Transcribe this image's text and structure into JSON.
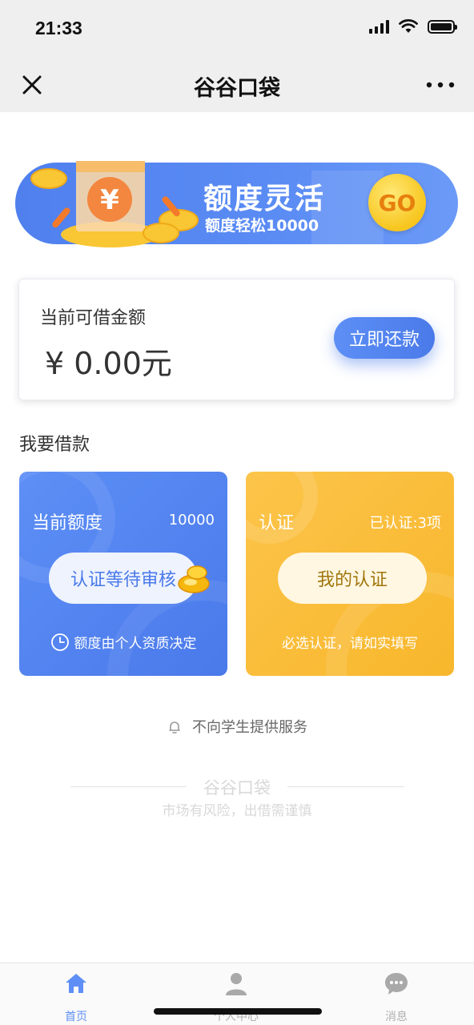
{
  "status_bar": {
    "time": "21:33"
  },
  "nav": {
    "title": "谷谷口袋"
  },
  "banner": {
    "title": "额度灵活",
    "subtitle": "额度轻松10000",
    "go_label": "GO"
  },
  "balance": {
    "label": "当前可借金额",
    "amount": "¥ 0.00元",
    "repay_label": "立即还款"
  },
  "section_title": "我要借款",
  "quota_card": {
    "title": "当前额度",
    "value": "10000",
    "button_label": "认证等待审核",
    "note": "额度由个人资质决定"
  },
  "verify_card": {
    "title": "认证",
    "status": "已认证:3项",
    "button_label": "我的认证",
    "note": "必选认证，请如实填写"
  },
  "notice": "不向学生提供服务",
  "brand": {
    "name": "谷谷口袋",
    "warning": "市场有风险，出借需谨慎"
  },
  "tabs": [
    {
      "label": "首页",
      "icon": "home-icon",
      "active": true
    },
    {
      "label": "个人中心",
      "icon": "user-icon",
      "active": false
    },
    {
      "label": "消息",
      "icon": "message-icon",
      "active": false
    }
  ],
  "colors": {
    "accent": "#5d8ff6",
    "gold": "#f8b72c"
  }
}
